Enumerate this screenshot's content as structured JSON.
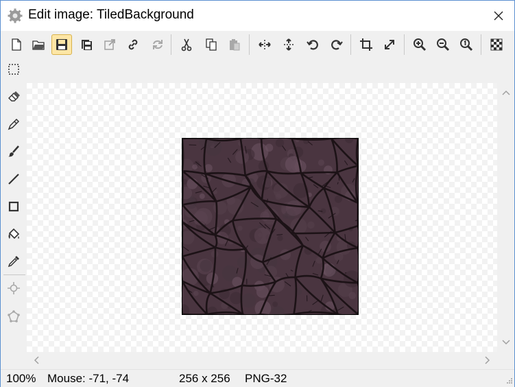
{
  "window": {
    "title": "Edit image: TiledBackground",
    "title_icon": "gear-icon",
    "close_icon": "close-icon"
  },
  "toolbar": {
    "buttons": [
      {
        "icon": "new-file-icon"
      },
      {
        "icon": "open-folder-icon"
      },
      {
        "icon": "save-icon",
        "active": true
      },
      {
        "icon": "save-copy-icon"
      },
      {
        "icon": "export-icon"
      },
      {
        "icon": "link-icon"
      },
      {
        "icon": "refresh-icon"
      },
      {
        "icon": "cut-icon"
      },
      {
        "icon": "copy-icon"
      },
      {
        "icon": "paste-icon"
      },
      {
        "icon": "flip-horizontal-icon"
      },
      {
        "icon": "flip-vertical-icon"
      },
      {
        "icon": "rotate-left-icon"
      },
      {
        "icon": "rotate-right-icon"
      },
      {
        "icon": "crop-icon"
      },
      {
        "icon": "resize-icon"
      },
      {
        "icon": "zoom-in-icon"
      },
      {
        "icon": "zoom-out-icon"
      },
      {
        "icon": "zoom-actual-icon"
      },
      {
        "icon": "transparency-grid-icon"
      }
    ]
  },
  "tools": [
    {
      "icon": "marquee-select-icon"
    },
    {
      "icon": "eraser-icon"
    },
    {
      "icon": "pencil-icon"
    },
    {
      "icon": "brush-icon"
    },
    {
      "icon": "line-icon"
    },
    {
      "icon": "rectangle-icon"
    },
    {
      "icon": "fill-bucket-icon"
    },
    {
      "icon": "eyedropper-icon"
    },
    {
      "icon": "origin-point-icon"
    },
    {
      "icon": "polygon-mask-icon"
    }
  ],
  "canvas": {
    "image_alt": "cracked stone tile texture",
    "bg_color": "#4a3540",
    "crack_color": "#1c1216"
  },
  "status": {
    "zoom": "100%",
    "mouse": "Mouse: -71, -74",
    "size": "256 x 256",
    "format": "PNG-32"
  },
  "colors": {
    "active_button_bg": "#fde6a6",
    "window_border": "#5a8fd0"
  }
}
